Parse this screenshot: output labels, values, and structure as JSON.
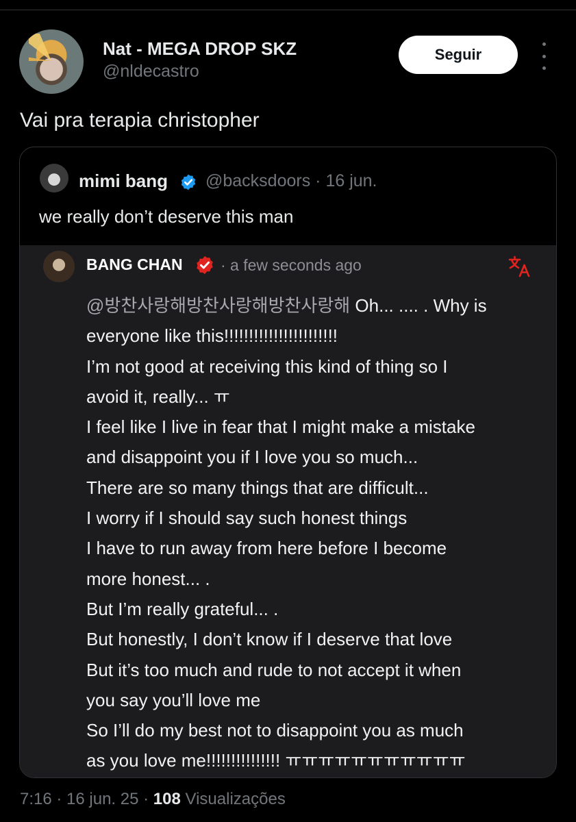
{
  "author": {
    "display_name": "Nat - MEGA DROP SKZ",
    "handle": "@nldecastro",
    "follow_label": "Seguir"
  },
  "tweet": {
    "text": "Vai pra terapia christopher"
  },
  "quote": {
    "name": "mimi bang",
    "handle_date": "@backsdoors · 16 jun.",
    "text": "we really don’t deserve this man",
    "media": {
      "name": "BANG CHAN",
      "time": "· a few seconds ago",
      "mention": "@방찬사랑해방찬사랑해방찬사랑해",
      "first_line_rest": " Oh... .... . Why is",
      "lines": [
        "everyone like this!!!!!!!!!!!!!!!!!!!!!!!",
        "I’m not good at receiving this kind of thing so I",
        "avoid it, really... ㅠ",
        "I feel like I live in fear that I might make a mistake",
        "and disappoint you if I love you so much...",
        "There are so many things that are difficult...",
        "I worry if I should say such honest things",
        "I have to run away from here before I become",
        "more honest... .",
        "But I’m really grateful... .",
        "But honestly, I don’t know if I deserve that love",
        "But it’s too much and rude to not accept it when",
        "you say you’ll love me",
        "So I’ll do my best not to disappoint you as much",
        "as you love me!!!!!!!!!!!!!!! ㅠㅠㅠㅠㅠㅠㅠㅠㅠㅠㅠ"
      ]
    }
  },
  "footer": {
    "time_date": "7:16 · 16 jun. 25 · ",
    "views_count": "108",
    "views_label": " Visualizações"
  },
  "colors": {
    "background": "#000000",
    "verified_blue": "#1d9bf0",
    "verified_red": "#e0241f",
    "media_background": "#1c1c1e"
  },
  "icons": [
    "more-icon",
    "verified-icon",
    "translate-icon"
  ]
}
